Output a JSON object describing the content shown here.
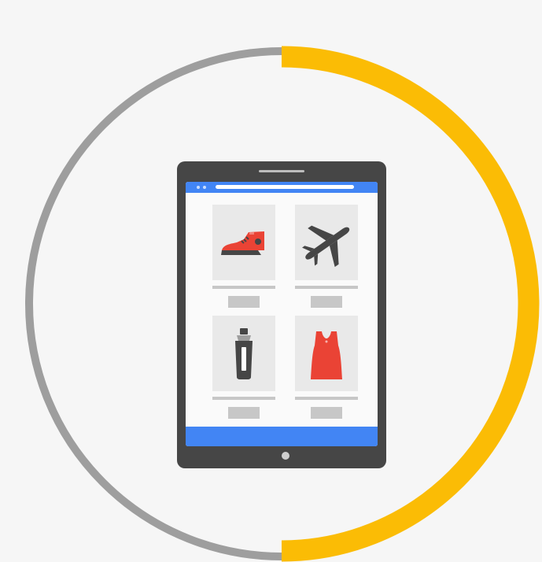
{
  "colors": {
    "background": "#f6f6f6",
    "ring_progress": "#fbbc05",
    "ring_track": "#9e9e9e",
    "tablet_body": "#464646",
    "browser_bar": "#4285f4",
    "product_red": "#ea4335",
    "product_dark": "#464646",
    "placeholder": "#c7c7c7"
  },
  "progress_ring": {
    "progress_fraction": 0.5
  },
  "products": [
    {
      "icon": "sneaker-icon"
    },
    {
      "icon": "airplane-icon"
    },
    {
      "icon": "cocktail-shaker-icon"
    },
    {
      "icon": "sleeveless-top-icon"
    }
  ]
}
